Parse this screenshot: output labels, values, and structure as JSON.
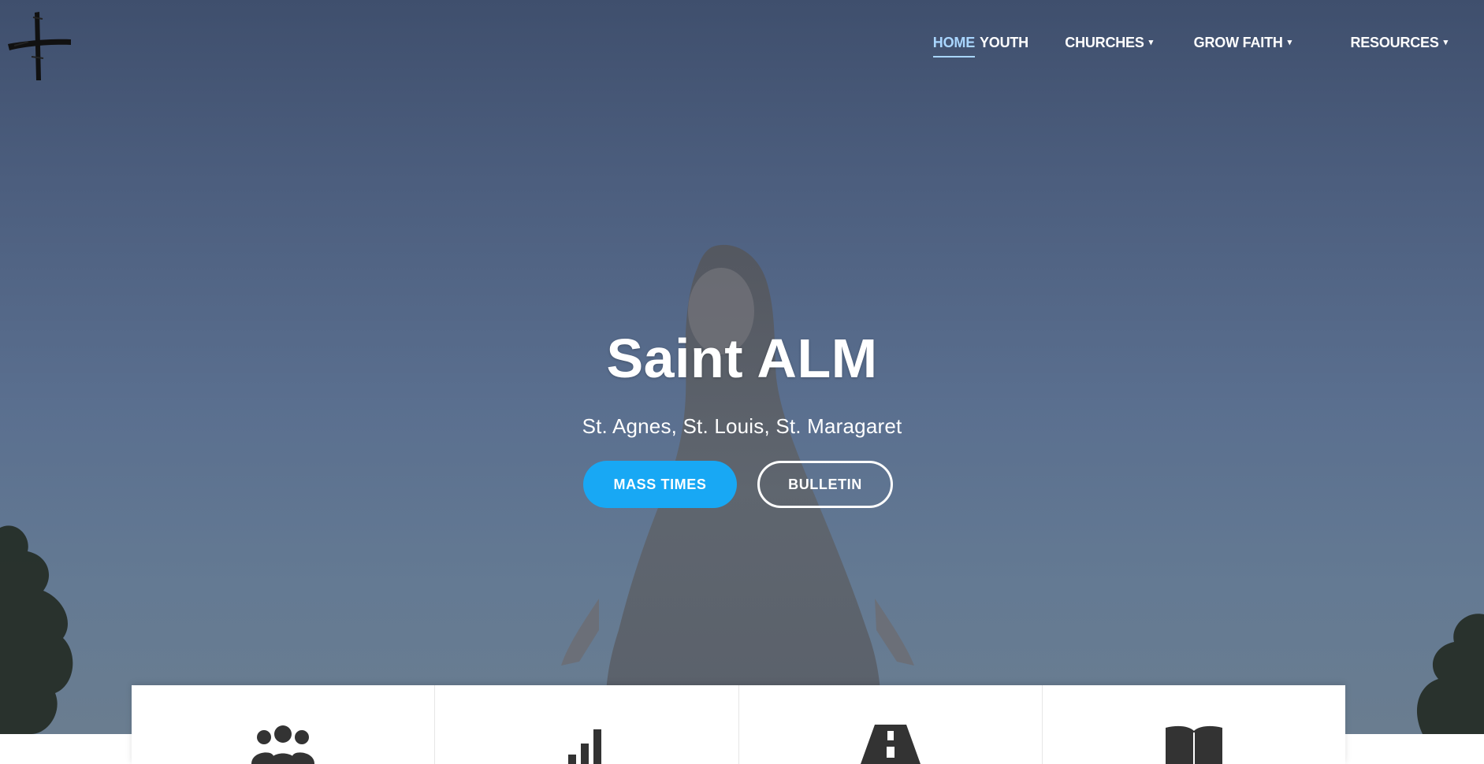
{
  "nav": {
    "items": [
      {
        "label": "HOME",
        "active": true,
        "dropdown": false
      },
      {
        "label": "YOUTH",
        "active": false,
        "dropdown": false
      },
      {
        "label": "CHURCHES",
        "active": false,
        "dropdown": true
      },
      {
        "label": "GROW FAITH",
        "active": false,
        "dropdown": true
      },
      {
        "label": "RESOURCES",
        "active": false,
        "dropdown": true
      }
    ],
    "active_color": "#a9d6ff"
  },
  "hero": {
    "title": "Saint ALM",
    "subtitle": "St. Agnes, St. Louis, St. Maragaret",
    "primary_button": "MASS TIMES",
    "secondary_button": "BULLETIN",
    "primary_color": "#18a8f4"
  },
  "feature_cards": [
    {
      "icon": "people-icon"
    },
    {
      "icon": "signal-bars-icon"
    },
    {
      "icon": "road-icon"
    },
    {
      "icon": "book-icon"
    }
  ]
}
